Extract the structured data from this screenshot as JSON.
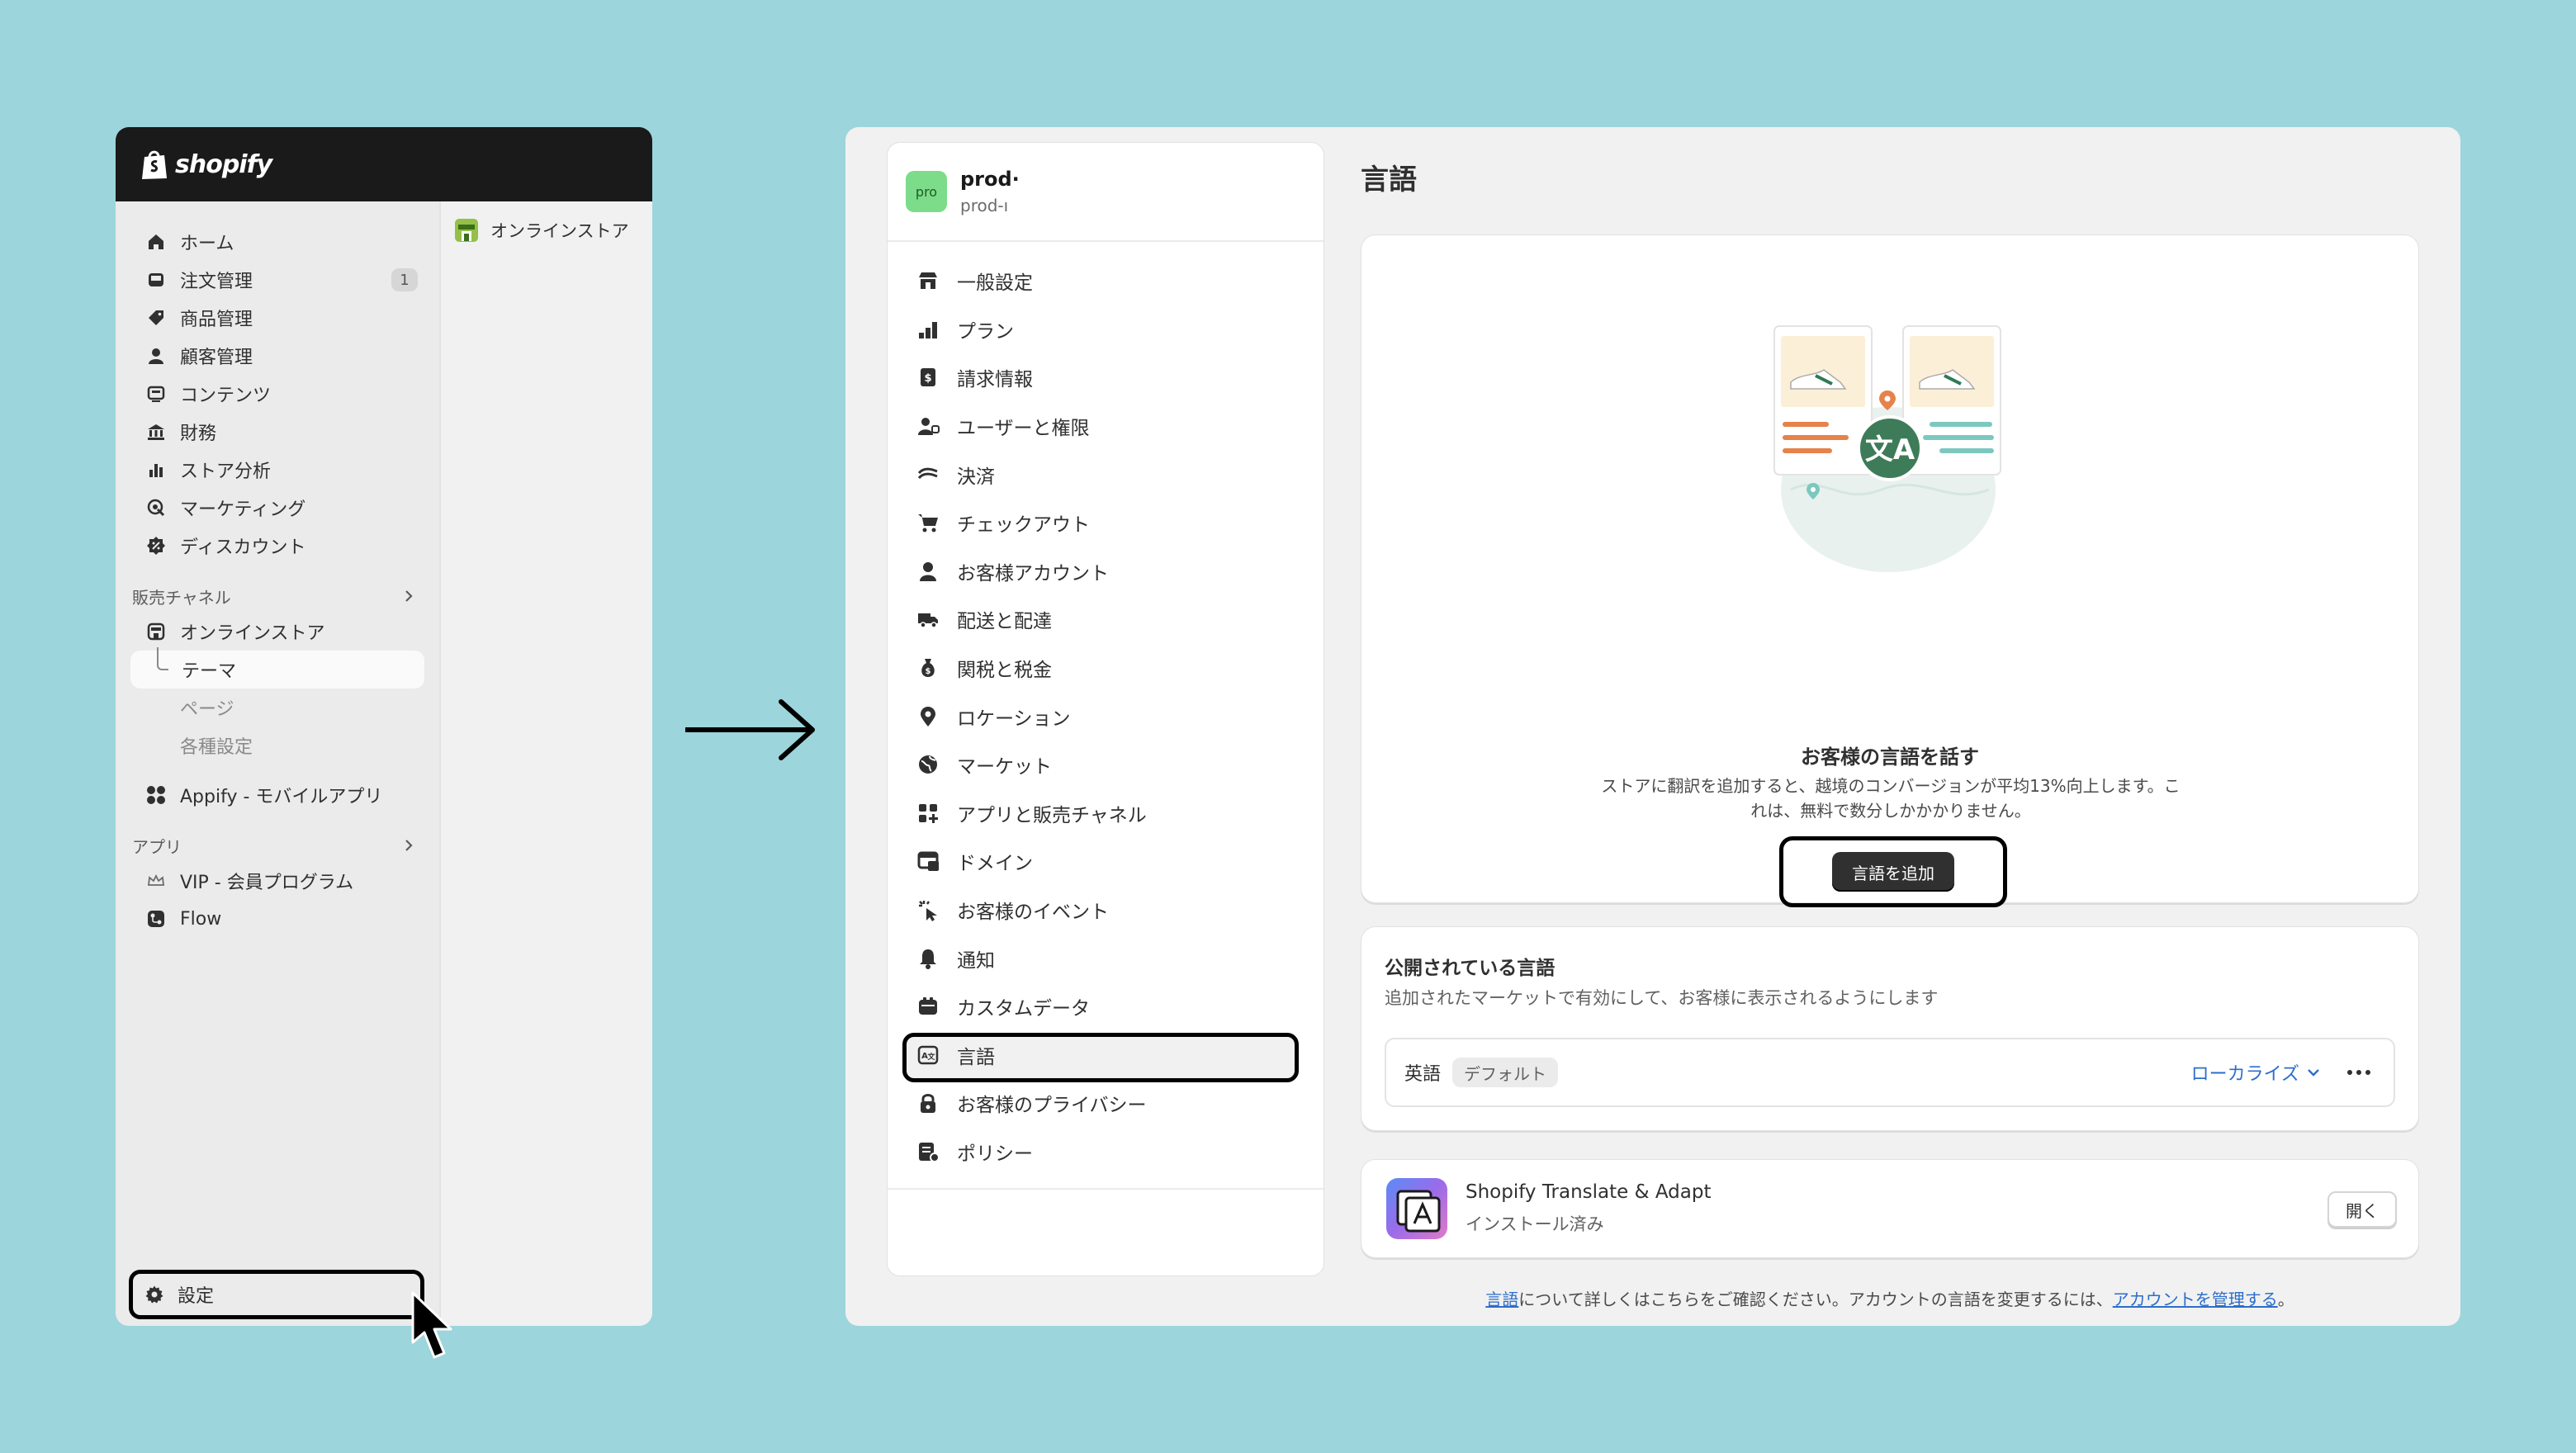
{
  "admin": {
    "logo_text": "shopify",
    "nav": [
      {
        "label": "ホーム",
        "icon": "home-icon"
      },
      {
        "label": "注文管理",
        "icon": "inbox-icon",
        "badge": "1"
      },
      {
        "label": "商品管理",
        "icon": "tag-icon"
      },
      {
        "label": "顧客管理",
        "icon": "person-icon"
      },
      {
        "label": "コンテンツ",
        "icon": "content-icon"
      },
      {
        "label": "財務",
        "icon": "bank-icon"
      },
      {
        "label": "ストア分析",
        "icon": "bar-chart-icon"
      },
      {
        "label": "マーケティング",
        "icon": "target-icon"
      },
      {
        "label": "ディスカウント",
        "icon": "discount-icon"
      }
    ],
    "sales_channels_label": "販売チャネル",
    "online_store": "オンラインストア",
    "online_store_sub": [
      "テーマ",
      "ページ",
      "各種設定"
    ],
    "appify": "Appify - モバイルアプリ",
    "apps_label": "アプリ",
    "apps": [
      "VIP - 会員プログラム",
      "Flow"
    ],
    "settings_label": "設定",
    "subpane_item": "オンラインストア"
  },
  "settings": {
    "store_avatar": "pro",
    "store_name": "prod·",
    "store_domain": "prod-ı",
    "menu": [
      {
        "label": "一般設定",
        "icon": "store-icon"
      },
      {
        "label": "プラン",
        "icon": "plan-icon"
      },
      {
        "label": "請求情報",
        "icon": "billing-icon"
      },
      {
        "label": "ユーザーと権限",
        "icon": "users-icon"
      },
      {
        "label": "決済",
        "icon": "payment-icon"
      },
      {
        "label": "チェックアウト",
        "icon": "cart-icon"
      },
      {
        "label": "お客様アカウント",
        "icon": "person-icon"
      },
      {
        "label": "配送と配達",
        "icon": "truck-icon"
      },
      {
        "label": "関税と税金",
        "icon": "tax-icon"
      },
      {
        "label": "ロケーション",
        "icon": "location-icon"
      },
      {
        "label": "マーケット",
        "icon": "globe-icon"
      },
      {
        "label": "アプリと販売チャネル",
        "icon": "apps-icon"
      },
      {
        "label": "ドメイン",
        "icon": "domain-icon"
      },
      {
        "label": "お客様のイベント",
        "icon": "events-icon"
      },
      {
        "label": "通知",
        "icon": "bell-icon"
      },
      {
        "label": "カスタムデータ",
        "icon": "database-icon"
      },
      {
        "label": "言語",
        "icon": "language-icon",
        "active": true
      },
      {
        "label": "お客様のプライバシー",
        "icon": "lock-icon"
      },
      {
        "label": "ポリシー",
        "icon": "policy-icon"
      }
    ],
    "page_title": "言語",
    "hero": {
      "title": "お客様の言語を話す",
      "description": "ストアに翻訳を追加すると、越境のコンバージョンが平均13%向上します。これは、無料で数分しかかかりません。",
      "button": "言語を追加"
    },
    "published": {
      "title": "公開されている言語",
      "description": "追加されたマーケットで有効にして、お客様に表示されるようにします",
      "language": "英語",
      "badge": "デフォルト",
      "localize": "ローカライズ"
    },
    "app": {
      "name": "Shopify Translate & Adapt",
      "status": "インストール済み",
      "open": "開く"
    },
    "footer": {
      "link1": "言語",
      "text1": "について詳しくはこちらをご確認ください。アカウントの言語を変更するには、",
      "link2": "アカウントを管理する",
      "text2": "。"
    }
  }
}
